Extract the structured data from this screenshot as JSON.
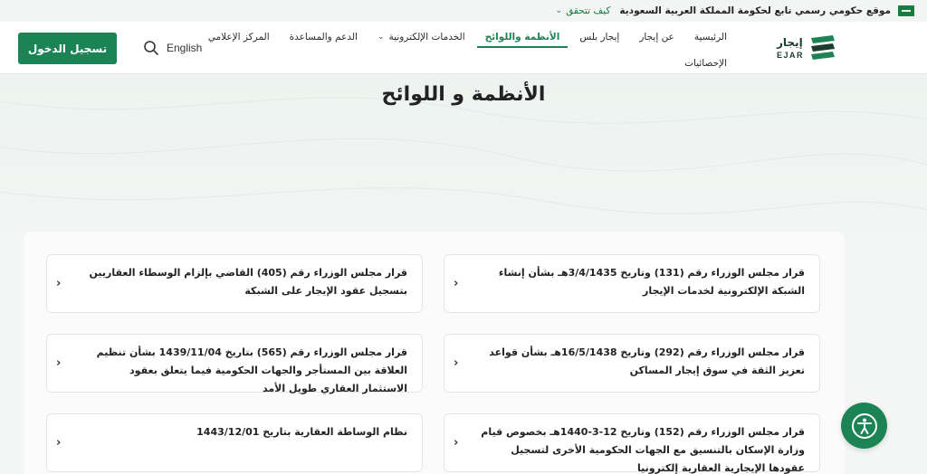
{
  "topbar": {
    "official_text": "موقع حكومي رسمي تابع لحكومة المملكة العربية السعودية",
    "verify_text": "كيف تتحقق"
  },
  "header": {
    "login_label": "تسجيل الدخول",
    "language_label": "English",
    "logo_ar": "إيجار",
    "logo_en": "EJAR",
    "nav": [
      {
        "label": "الرئيسية",
        "active": false
      },
      {
        "label": "عن إيجار",
        "active": false
      },
      {
        "label": "إيجار بلس",
        "active": false
      },
      {
        "label": "الأنظمة واللوائح",
        "active": true
      },
      {
        "label": "الخدمات الإلكترونية",
        "active": false,
        "dropdown": true
      },
      {
        "label": "الدعم والمساعدة",
        "active": false
      },
      {
        "label": "المركز الإعلامي",
        "active": false
      }
    ],
    "nav_row2": [
      {
        "label": "الإحصائيات"
      }
    ]
  },
  "hero": {
    "title": "الأنظمة و اللوائح"
  },
  "cards": [
    {
      "text": "قرار مجلس الوزراء رقم (131) وتاريخ 3/4/1435هـ بشأن إنشاء الشبكة الإلكترونية لخدمات الإيجار"
    },
    {
      "text": "قرار مجلس الوزراء رقم (405) القاضي بإلزام الوسطاء العقاريين بتسجيل عقود الإيجار على الشبكة"
    },
    {
      "text": "قرار مجلس الوزراء رقم (292) وتاريخ 16/5/1438هـ بشأن قواعد تعزيز الثقة في سوق إيجار المساكن"
    },
    {
      "text": "قرار مجلس الوزراء رقم (565) بتاريخ 1439/11/04 بشأن تنظيم العلاقة بين المستأجر والجهات الحكومية فيما يتعلق بعقود الاستثمار العقاري طويل الأمد"
    },
    {
      "text": "قرار مجلس الوزراء رقم (152) وتاريخ 12-3-1440هـ بخصوص قيام وزارة الإسكان بالتنسيق مع الجهات الحكومية الأخرى لتسجيل عقودها الإيجارية العقارية إلكترونيا"
    },
    {
      "text": "نظام الوساطة العقارية بتاريخ 1443/12/01"
    }
  ],
  "colors": {
    "brand": "#1b8354",
    "logo_dark": "#1c3d2e"
  }
}
